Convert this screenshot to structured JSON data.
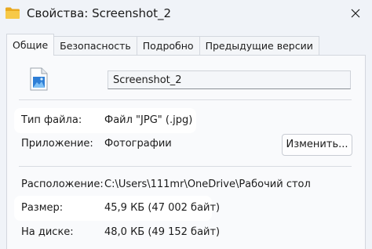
{
  "window": {
    "title": "Свойства: Screenshot_2",
    "close_glyph": "✕"
  },
  "tabs": [
    {
      "label": "Общие",
      "active": true
    },
    {
      "label": "Безопасность",
      "active": false
    },
    {
      "label": "Подробно",
      "active": false
    },
    {
      "label": "Предыдущие версии",
      "active": false
    }
  ],
  "general": {
    "file_name": "Screenshot_2",
    "file_type": {
      "label": "Тип файла:",
      "value": "Файл \"JPG\" (.jpg)"
    },
    "application": {
      "label": "Приложение:",
      "value": "Фотографии",
      "change_button": "Изменить..."
    },
    "location": {
      "label": "Расположение:",
      "value": "C:\\Users\\111mr\\OneDrive\\Рабочий стол"
    },
    "size": {
      "label": "Размер:",
      "value": "45,9 КБ (47 002 байт)"
    },
    "size_on_disk": {
      "label": "На диске:",
      "value": "48,0 КБ (49 152 байт)"
    }
  },
  "icons": {
    "title_icon": "folder-icon",
    "file_icon": "image-file-icon",
    "close": "close-icon"
  },
  "colors": {
    "window_bg": "#f0f3f8",
    "panel_bg": "#f9fafc",
    "highlight": "#ffffff",
    "folder_yellow": "#f5c142",
    "image_blue": "#2f7fd6"
  }
}
